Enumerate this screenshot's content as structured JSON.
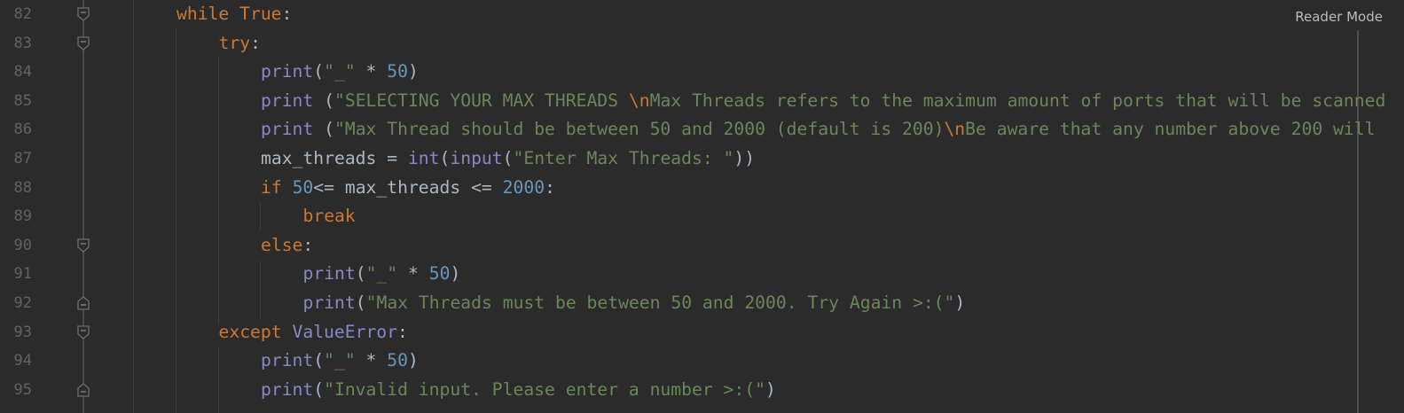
{
  "editor": {
    "reader_mode_label": "Reader Mode",
    "lines": [
      {
        "number": "82",
        "indent": 0,
        "fold": "open",
        "tokens": [
          [
            "kw",
            "while "
          ],
          [
            "kw",
            "True"
          ],
          [
            "plain",
            ":"
          ]
        ]
      },
      {
        "number": "83",
        "indent": 1,
        "fold": "open",
        "tokens": [
          [
            "kw",
            "try"
          ],
          [
            "plain",
            ":"
          ]
        ]
      },
      {
        "number": "84",
        "indent": 2,
        "fold": "",
        "tokens": [
          [
            "bi",
            "print"
          ],
          [
            "plain",
            "("
          ],
          [
            "str",
            "\"_\""
          ],
          [
            "plain",
            " * "
          ],
          [
            "num",
            "50"
          ],
          [
            "plain",
            ")"
          ]
        ]
      },
      {
        "number": "85",
        "indent": 2,
        "fold": "",
        "tokens": [
          [
            "bi",
            "print"
          ],
          [
            "plain",
            " ("
          ],
          [
            "str",
            "\"SELECTING YOUR MAX THREADS "
          ],
          [
            "esc",
            "\\n"
          ],
          [
            "str",
            "Max Threads refers to the maximum amount of ports that will be scanned"
          ]
        ]
      },
      {
        "number": "86",
        "indent": 2,
        "fold": "",
        "tokens": [
          [
            "bi",
            "print"
          ],
          [
            "plain",
            " ("
          ],
          [
            "str",
            "\"Max Thread should be between 50 and 2000 (default is 200)"
          ],
          [
            "esc",
            "\\n"
          ],
          [
            "str",
            "Be aware that any number above 200 will "
          ]
        ]
      },
      {
        "number": "87",
        "indent": 2,
        "fold": "",
        "tokens": [
          [
            "plain",
            "max_threads = "
          ],
          [
            "bi",
            "int"
          ],
          [
            "plain",
            "("
          ],
          [
            "bi",
            "input"
          ],
          [
            "plain",
            "("
          ],
          [
            "str",
            "\"Enter Max Threads: \""
          ],
          [
            "plain",
            "))"
          ]
        ]
      },
      {
        "number": "88",
        "indent": 2,
        "fold": "",
        "tokens": [
          [
            "kw",
            "if "
          ],
          [
            "num",
            "50"
          ],
          [
            "plain",
            "<= max_threads <= "
          ],
          [
            "num",
            "2000"
          ],
          [
            "plain",
            ":"
          ]
        ]
      },
      {
        "number": "89",
        "indent": 3,
        "fold": "",
        "tokens": [
          [
            "kw",
            "break"
          ]
        ]
      },
      {
        "number": "90",
        "indent": 2,
        "fold": "open",
        "tokens": [
          [
            "kw",
            "else"
          ],
          [
            "plain",
            ":"
          ]
        ]
      },
      {
        "number": "91",
        "indent": 3,
        "fold": "",
        "tokens": [
          [
            "bi",
            "print"
          ],
          [
            "plain",
            "("
          ],
          [
            "str",
            "\"_\""
          ],
          [
            "plain",
            " * "
          ],
          [
            "num",
            "50"
          ],
          [
            "plain",
            ")"
          ]
        ]
      },
      {
        "number": "92",
        "indent": 3,
        "fold": "close",
        "tokens": [
          [
            "bi",
            "print"
          ],
          [
            "plain",
            "("
          ],
          [
            "str",
            "\"Max Threads must be between 50 and 2000. Try Again >:(\""
          ],
          [
            "plain",
            ")"
          ]
        ]
      },
      {
        "number": "93",
        "indent": 1,
        "fold": "open",
        "tokens": [
          [
            "kw",
            "except "
          ],
          [
            "bi",
            "ValueError"
          ],
          [
            "plain",
            ":"
          ]
        ]
      },
      {
        "number": "94",
        "indent": 2,
        "fold": "",
        "tokens": [
          [
            "bi",
            "print"
          ],
          [
            "plain",
            "("
          ],
          [
            "str",
            "\"_\""
          ],
          [
            "plain",
            " * "
          ],
          [
            "num",
            "50"
          ],
          [
            "plain",
            ")"
          ]
        ]
      },
      {
        "number": "95",
        "indent": 2,
        "fold": "close",
        "tokens": [
          [
            "bi",
            "print"
          ],
          [
            "plain",
            "("
          ],
          [
            "str",
            "\"Invalid input. Please enter a number >:(\""
          ],
          [
            "plain",
            ")"
          ]
        ]
      }
    ]
  }
}
